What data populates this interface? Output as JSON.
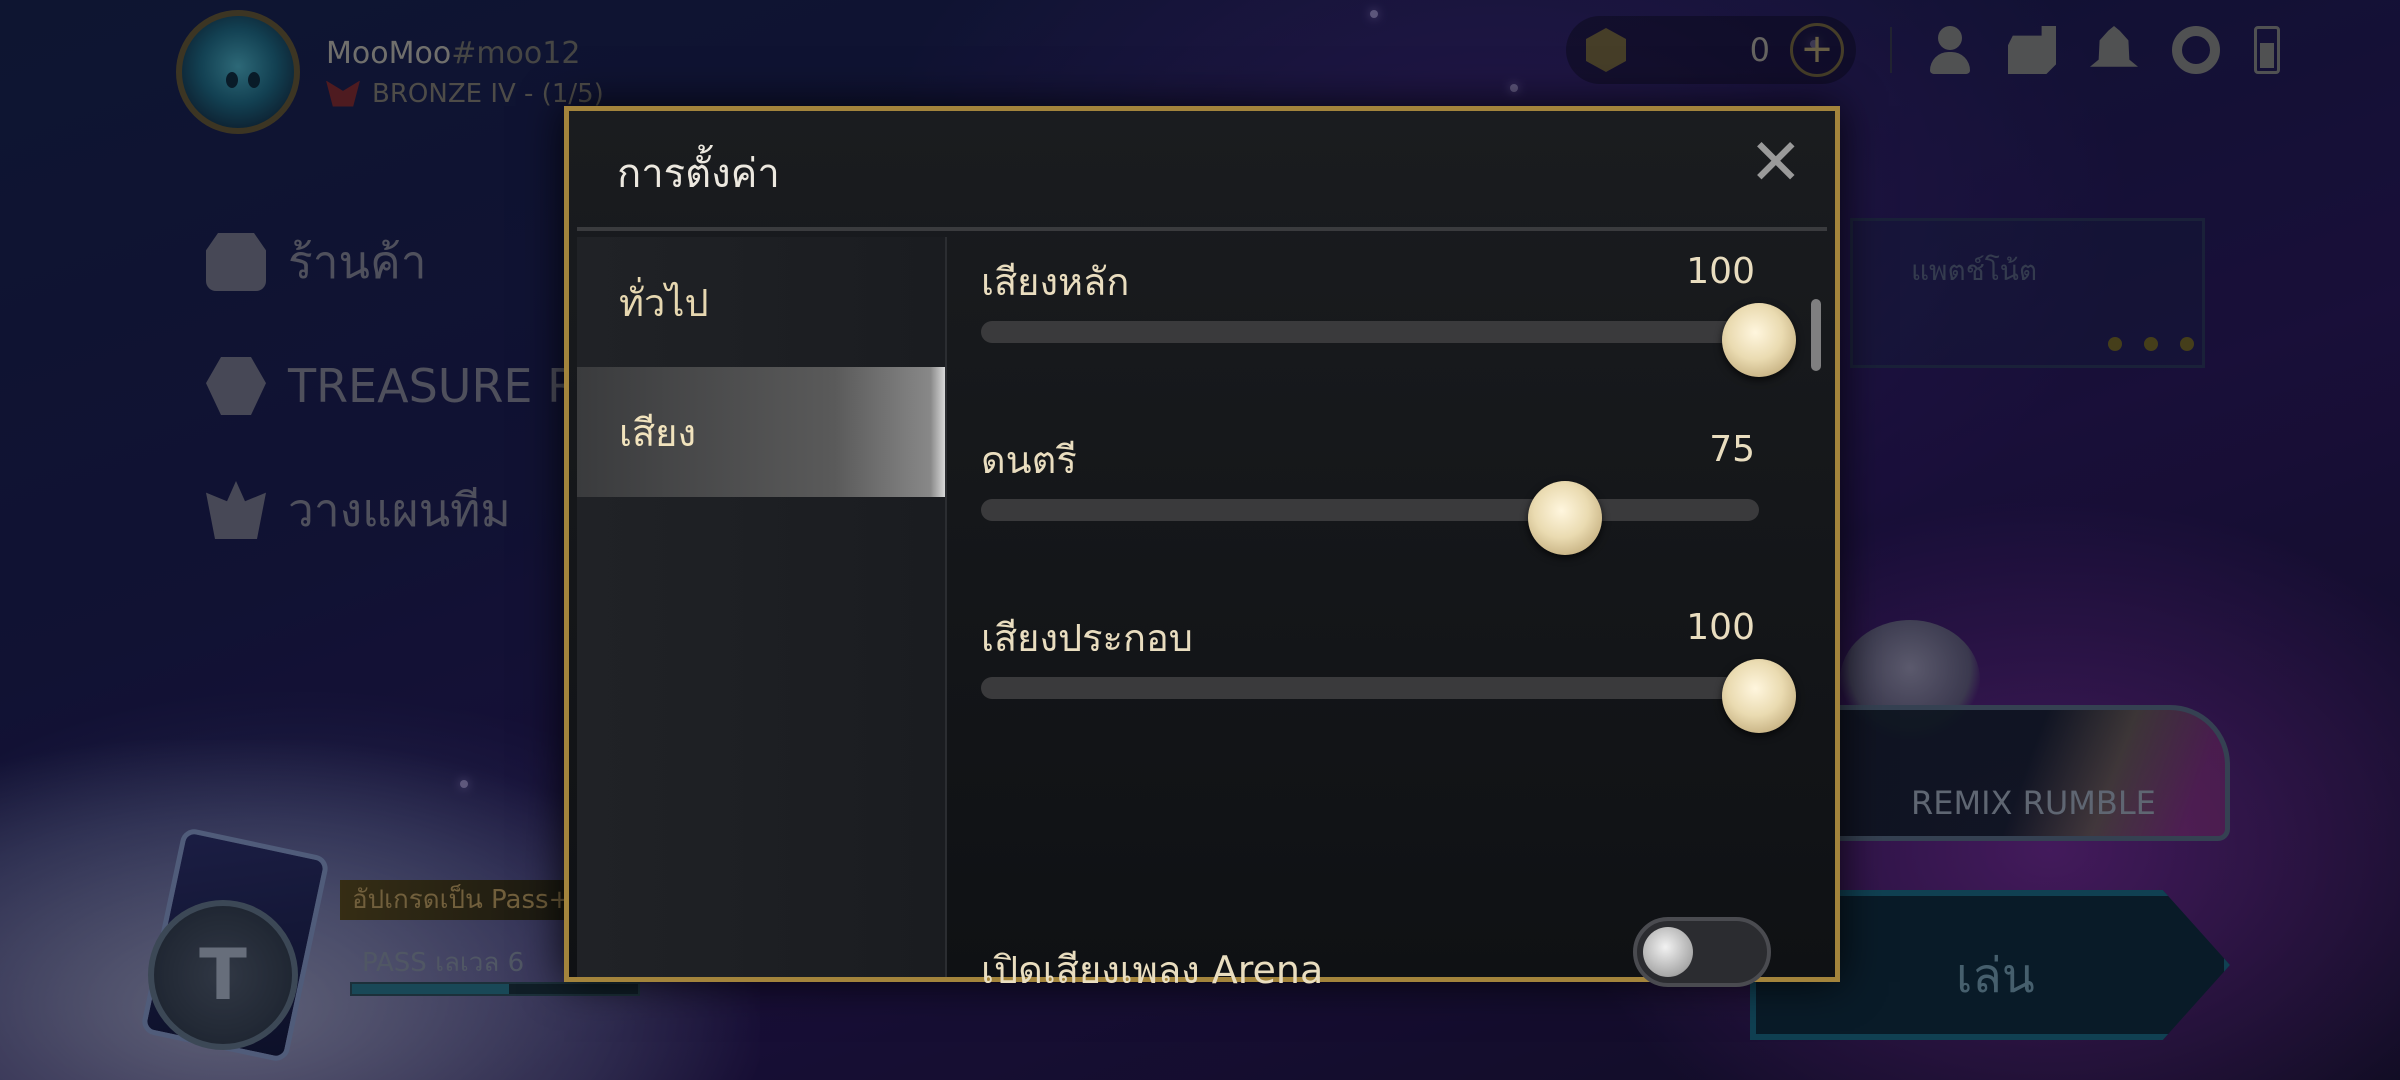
{
  "player": {
    "name": "MooMoo",
    "tag": "#moo12",
    "rank": "BRONZE IV - (1/5)"
  },
  "currency": {
    "amount": "0"
  },
  "icons": [
    "plus-icon",
    "profile-icon",
    "collection-icon",
    "notification-bell-icon",
    "settings-gear-icon",
    "battery-icon"
  ],
  "left_menu": {
    "items": [
      {
        "label": "ร้านค้า",
        "icon": "shop-icon"
      },
      {
        "label": "TREASURE R",
        "icon": "treasure-icon"
      },
      {
        "label": "วางแผนทีม",
        "icon": "team-planner-icon"
      }
    ]
  },
  "patch_notes": {
    "label": "แพตช์โน้ต"
  },
  "game_mode": {
    "label": "REMIX RUMBLE"
  },
  "play_button": {
    "label": "เล่น"
  },
  "pass": {
    "upgrade_label": "อัปเกรดเป็น Pass+",
    "level_label": "PASS เลเวล 6",
    "progress": 0.55
  },
  "settings_modal": {
    "title": "การตั้งค่า",
    "close_symbol": "✕",
    "tabs": [
      {
        "label": "ทั่วไป",
        "active": false
      },
      {
        "label": "เสียง",
        "active": true
      }
    ],
    "sliders": [
      {
        "label": "เสียงหลัก",
        "value": "100",
        "level": 1.0
      },
      {
        "label": "ดนตรี",
        "value": "75",
        "level": 0.75
      },
      {
        "label": "เสียงประกอบ",
        "value": "100",
        "level": 1.0
      }
    ],
    "toggle": {
      "label": "เปิดเสียงเพลง Arena",
      "on": false
    }
  },
  "colors": {
    "modal_border": "#a3843c",
    "label_text": "#e9ddbf",
    "knob": "#eadbb1"
  }
}
